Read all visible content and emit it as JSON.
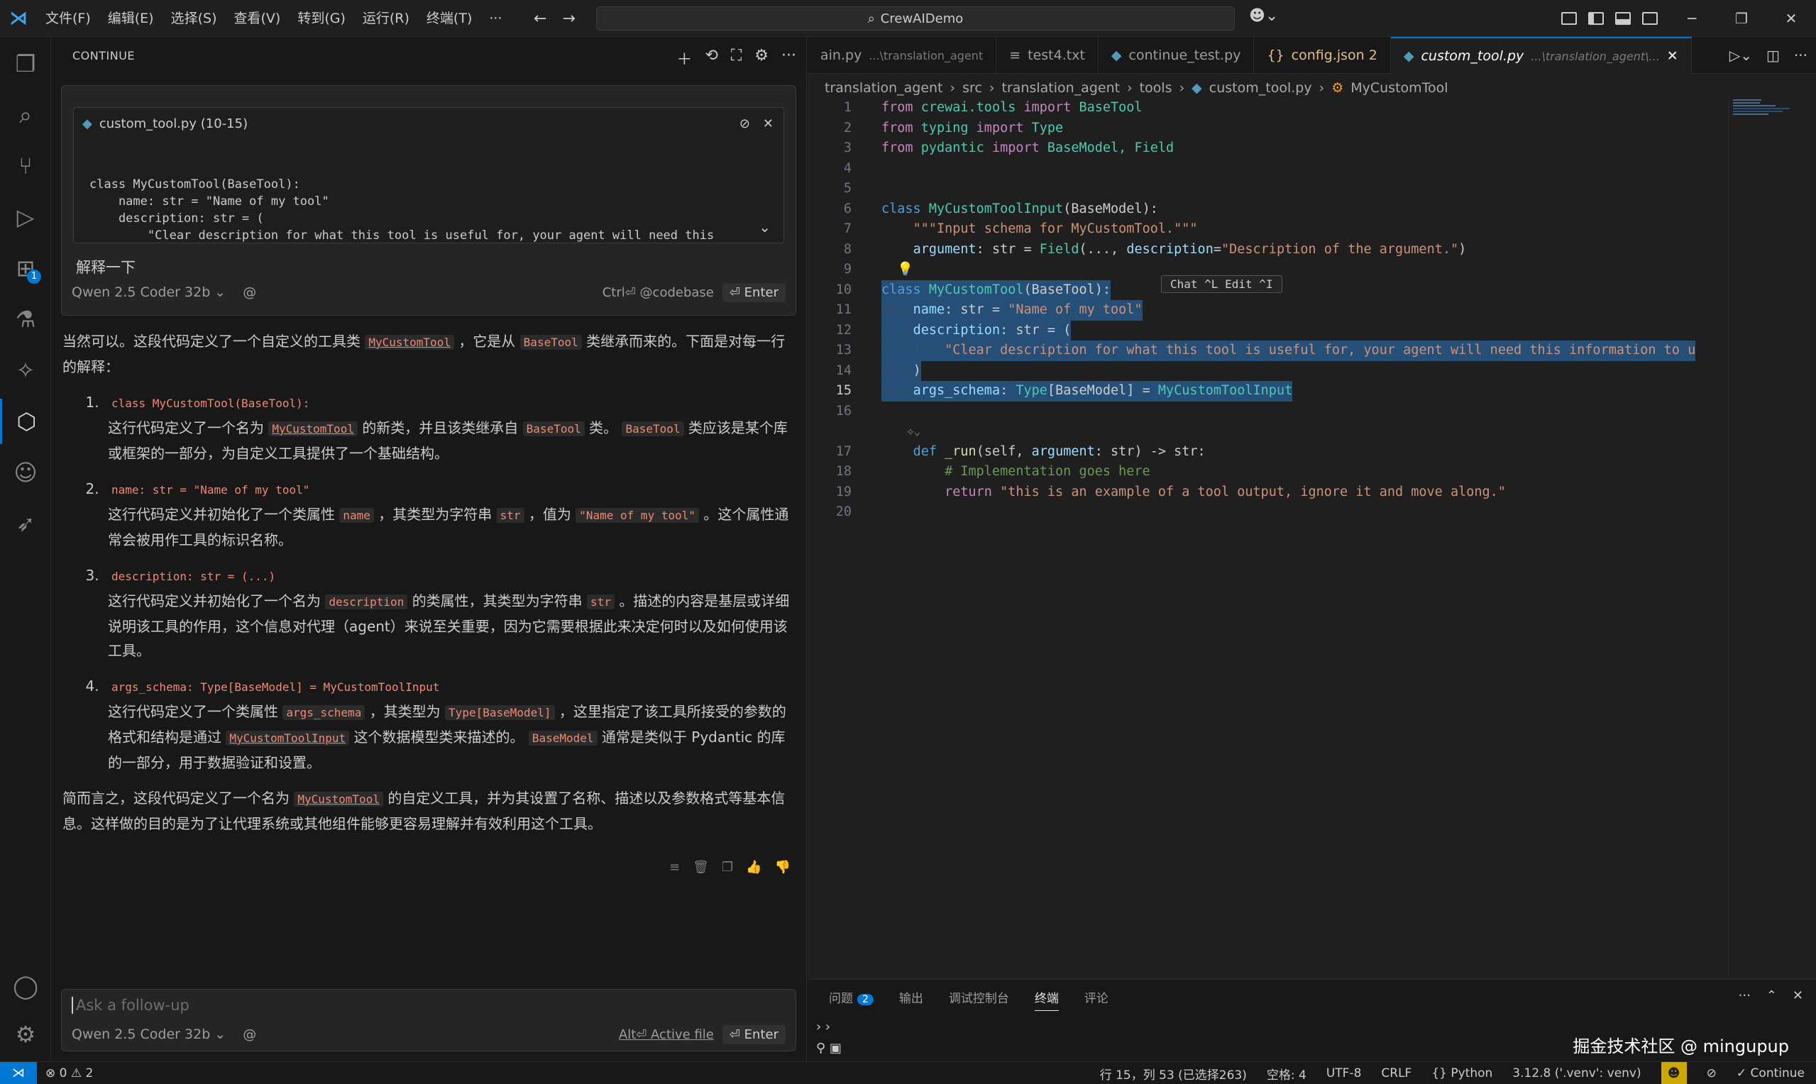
{
  "titlebar": {
    "menus": [
      "文件(F)",
      "编辑(E)",
      "选择(S)",
      "查看(V)",
      "转到(G)",
      "运行(R)",
      "终端(T)",
      "···"
    ],
    "search": "CrewAIDemo"
  },
  "activity_badge": "1",
  "chat": {
    "header": "CONTINUE",
    "context_title": "custom_tool.py (10-15)",
    "context_code": "class MyCustomTool(BaseTool):\n    name: str = \"Name of my tool\"\n    description: str = (\n        \"Clear description for what this tool is useful for, your agent will need this\ninformation to use it.\"",
    "prompt": "解释一下",
    "model": "Qwen 2.5 Coder 32b",
    "codebase_hint": "Ctrl⏎ @codebase",
    "enter_label": "⏎ Enter",
    "followup_placeholder": "Ask a follow-up",
    "active_file_hint": "Alt⏎ Active file",
    "response": {
      "intro_a": "当然可以。这段代码定义了一个自定义的工具类",
      "intro_code1": "MyCustomTool",
      "intro_b": "，它是从",
      "intro_code2": "BaseTool",
      "intro_c": "类继承而来的。下面是对每一行的解释：",
      "items": [
        {
          "code": "class MyCustomTool(BaseTool):",
          "t1": "这行代码定义了一个名为",
          "c1": "MyCustomTool",
          "t2": "的新类，并且该类继承自",
          "c2": "BaseTool",
          "t3": "类。",
          "c3": "BaseTool",
          "t4": "类应该是某个库或框架的一部分，为自定义工具提供了一个基础结构。"
        },
        {
          "code": "name: str = \"Name of my tool\"",
          "t1": "这行代码定义并初始化了一个类属性",
          "c1": "name",
          "t2": "，其类型为字符串",
          "c2": "str",
          "t3": "，值为",
          "c3": "\"Name of my tool\"",
          "t4": "。这个属性通常会被用作工具的标识名称。"
        },
        {
          "code": "description: str = (...)",
          "t1": "这行代码定义并初始化了一个名为",
          "c1": "description",
          "t2": "的类属性，其类型为字符串",
          "c2": "str",
          "t3": "。描述的内容是基层或详细说明该工具的作用，这个信息对代理（agent）来说至关重要，因为它需要根据此来决定何时以及如何使用该工具。"
        },
        {
          "code": "args_schema: Type[BaseModel] = MyCustomToolInput",
          "t1": "这行代码定义了一个类属性",
          "c1": "args_schema",
          "t2": "，其类型为",
          "c2": "Type[BaseModel]",
          "t3": "，这里指定了该工具所接受的参数的格式和结构是通过",
          "c3": "MyCustomToolInput",
          "t4": "这个数据模型类来描述的。",
          "c4": "BaseModel",
          "t5": "通常是类似于 Pydantic 的库的一部分，用于数据验证和设置。"
        }
      ],
      "summary_a": "简而言之，这段代码定义了一个名为",
      "summary_code": "MyCustomTool",
      "summary_b": "的自定义工具，并为其设置了名称、描述以及参数格式等基本信息。这样做的目的是为了让代理系统或其他组件能够更容易理解并有效利用这个工具。"
    }
  },
  "editor": {
    "tabs": [
      {
        "name": "ain.py",
        "sub": "...\\translation_agent"
      },
      {
        "name": "test4.txt",
        "sub": ""
      },
      {
        "name": "continue_test.py",
        "sub": ""
      },
      {
        "name": "config.json 2",
        "sub": ""
      },
      {
        "name": "custom_tool.py",
        "sub": "...\\translation_agent\\..."
      }
    ],
    "breadcrumb": [
      "translation_agent",
      "src",
      "translation_agent",
      "tools",
      "custom_tool.py",
      "MyCustomTool"
    ],
    "inline_hint": "Chat ^L    Edit ^I",
    "lines": {
      "l1": {
        "a": "from",
        "b": "crewai.tools",
        "c": "import",
        "d": "BaseTool"
      },
      "l2": {
        "a": "from",
        "b": "typing",
        "c": "import",
        "d": "Type"
      },
      "l3": {
        "a": "from",
        "b": "pydantic",
        "c": "import",
        "d": "BaseModel, Field"
      },
      "l6": {
        "a": "class",
        "b": "MyCustomToolInput",
        "c": "(BaseModel):"
      },
      "l7": "\"\"\"Input schema for MyCustomTool.\"\"\"",
      "l8": {
        "a": "argument",
        "b": ": str = ",
        "c": "Field",
        "d": "(..., ",
        "e": "description",
        "f": "=",
        "g": "\"Description of the argument.\"",
        "h": ")"
      },
      "l10": {
        "a": "class",
        "b": "MyCustomTool",
        "c": "(BaseTool):"
      },
      "l11": {
        "a": "name",
        "b": ": str = ",
        "c": "\"Name of my tool\""
      },
      "l12": {
        "a": "description",
        "b": ": str = ("
      },
      "l13": "\"Clear description for what this tool is useful for, your agent will need this information to u",
      "l14": ")",
      "l15": {
        "a": "args_schema",
        "b": ": ",
        "c": "Type",
        "d": "[BaseModel] = ",
        "e": "MyCustomToolInput"
      },
      "l17": {
        "a": "def",
        "b": "_run",
        "c": "(self, ",
        "d": "argument",
        "e": ": str) -> str:"
      },
      "l18": "# Implementation goes here",
      "l19": {
        "a": "return",
        "b": "\"this is an example of a tool output, ignore it and move along.\""
      }
    }
  },
  "panel": {
    "tabs": [
      "问题",
      "输出",
      "调试控制台",
      "终端",
      "评论"
    ],
    "problems_count": "2",
    "watermark": "掘金技术社区 @ mingupup"
  },
  "status": {
    "errors": "⊗ 0 ⚠ 2",
    "position": "行 15，列 53 (已选择263)",
    "spaces": "空格: 4",
    "encoding": "UTF-8",
    "eol": "CRLF",
    "lang": "{} Python",
    "interpreter": "3.12.8 ('.venv': venv)",
    "continue": "Continue"
  }
}
